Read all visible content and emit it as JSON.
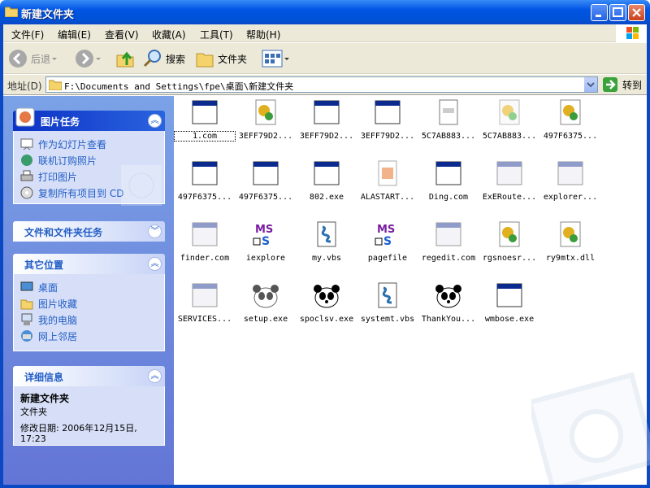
{
  "window": {
    "title": "新建文件夹"
  },
  "menu": [
    "文件(F)",
    "编辑(E)",
    "查看(V)",
    "收藏(A)",
    "工具(T)",
    "帮助(H)"
  ],
  "toolbar": {
    "back": "后退",
    "search": "搜索",
    "folders": "文件夹"
  },
  "address": {
    "label": "地址(D)",
    "path": "F:\\Documents and Settings\\fpe\\桌面\\新建文件夹",
    "go": "转到"
  },
  "picture_tasks": {
    "title": "图片任务",
    "items": [
      "作为幻灯片查看",
      "联机订购照片",
      "打印图片",
      "复制所有项目到 CD"
    ]
  },
  "file_tasks": {
    "title": "文件和文件夹任务"
  },
  "other_places": {
    "title": "其它位置",
    "items": [
      "桌面",
      "图片收藏",
      "我的电脑",
      "网上邻居"
    ]
  },
  "details": {
    "title": "详细信息",
    "name": "新建文件夹",
    "type": "文件夹",
    "modified": "修改日期: 2006年12月15日, 17:23"
  },
  "files": [
    {
      "name": "1.com",
      "icon": "window-icon"
    },
    {
      "name": "3EFF79D2...",
      "icon": "gear-icon"
    },
    {
      "name": "3EFF79D2...",
      "icon": "window-icon"
    },
    {
      "name": "3EFF79D2...",
      "icon": "window-icon"
    },
    {
      "name": "5C7AB883...",
      "icon": "document-icon"
    },
    {
      "name": "5C7AB883...",
      "icon": "gear-faded-icon"
    },
    {
      "name": "497F6375...",
      "icon": "gear-icon"
    },
    {
      "name": "497F6375...",
      "icon": "window-icon"
    },
    {
      "name": "497F6375...",
      "icon": "window-icon"
    },
    {
      "name": "802.exe",
      "icon": "window-icon"
    },
    {
      "name": "ALASTART...",
      "icon": "image-icon"
    },
    {
      "name": "Ding.com",
      "icon": "window-icon"
    },
    {
      "name": "ExERoute...",
      "icon": "window-faded-icon"
    },
    {
      "name": "explorer...",
      "icon": "window-faded-icon"
    },
    {
      "name": "finder.com",
      "icon": "window-faded-icon"
    },
    {
      "name": "iexplore",
      "icon": "ms-icon"
    },
    {
      "name": "my.vbs",
      "icon": "script-icon"
    },
    {
      "name": "pagefile",
      "icon": "ms-icon"
    },
    {
      "name": "regedit.com",
      "icon": "window-faded-icon"
    },
    {
      "name": "rgsnoesr...",
      "icon": "gear-icon"
    },
    {
      "name": "ry9mtx.dll",
      "icon": "gear-icon"
    },
    {
      "name": "SERVICES...",
      "icon": "window-faded-icon"
    },
    {
      "name": "setup.exe",
      "icon": "panda-faded-icon"
    },
    {
      "name": "spoclsv.exe",
      "icon": "panda-icon"
    },
    {
      "name": "systemt.vbs",
      "icon": "script-icon"
    },
    {
      "name": "ThankYou...",
      "icon": "panda-icon"
    },
    {
      "name": "wmbose.exe",
      "icon": "window-icon"
    }
  ]
}
